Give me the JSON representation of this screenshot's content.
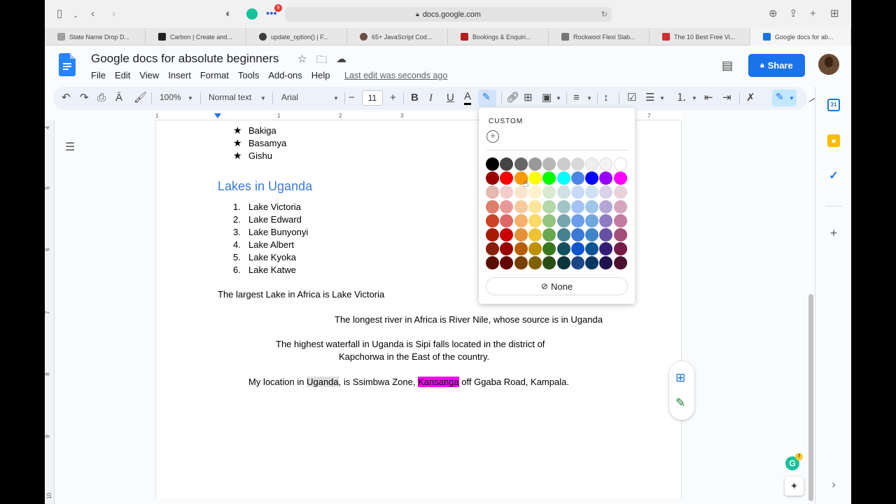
{
  "safari": {
    "url": "docs.google.com",
    "extension_badge": "9",
    "tabs": [
      {
        "label": "State Name Drop D...",
        "color": "#9e9e9e"
      },
      {
        "label": "Carbon | Create and...",
        "color": "#222222"
      },
      {
        "label": "update_option() | F...",
        "color": "#3c3c3c"
      },
      {
        "label": "65+ JavaScript Cod...",
        "color": "#6d4c41"
      },
      {
        "label": "Bookings & Enquiri...",
        "color": "#b71c1c"
      },
      {
        "label": "Rockwool Flexi Slab...",
        "color": "#757575"
      },
      {
        "label": "The 10 Best Free Vi...",
        "color": "#d32f2f"
      },
      {
        "label": "Google docs for ab...",
        "color": "#1a73e8"
      }
    ]
  },
  "docs": {
    "title": "Google docs for absolute beginners",
    "menu": [
      "File",
      "Edit",
      "View",
      "Insert",
      "Format",
      "Tools",
      "Add-ons",
      "Help"
    ],
    "last_edit": "Last edit was seconds ago",
    "share_label": "Share"
  },
  "toolbar": {
    "zoom": "100%",
    "style": "Normal text",
    "font": "Arial",
    "font_size": "11",
    "bold": "B",
    "italic": "I",
    "underline": "U",
    "text_color": "A",
    "minus": "−",
    "plus": "+"
  },
  "ruler": {
    "h_numbers": [
      "1",
      "1",
      "2",
      "3",
      "7"
    ],
    "v_numbers": [
      "4",
      "5",
      "6",
      "7",
      "8",
      "9",
      "10"
    ]
  },
  "document": {
    "star_items": [
      "Bakiga",
      "Basamya",
      "Gishu"
    ],
    "lakes_heading": "Lakes in Uganda",
    "lakes": [
      {
        "num": "1.",
        "name": "Lake Victoria"
      },
      {
        "num": "2.",
        "name": "Lake Edward"
      },
      {
        "num": "3.",
        "name": "Lake Bunyonyi"
      },
      {
        "num": "4.",
        "name": "Lake Albert"
      },
      {
        "num": "5.",
        "name": "Lake Kyoka"
      },
      {
        "num": "6.",
        "name": "Lake Katwe"
      }
    ],
    "largest_lake": "The largest Lake in Africa is Lake Victoria",
    "longest_river": "The longest river in Africa is River Nile, whose source is in Uganda",
    "waterfall_line1": "The highest waterfall in Uganda is Sipi falls located in the district of",
    "waterfall_line2": "Kapchorwa in the East of the country.",
    "location_pre": "My location in ",
    "location_hl1": "Uganda",
    "location_mid": ", is Ssimbwa Zone, ",
    "location_hl2": "Kansanga",
    "location_post": " off Ggaba Road, Kampala."
  },
  "highlight_palette": {
    "custom_label": "CUSTOM",
    "none_label": "None",
    "rows": [
      [
        "#000000",
        "#434343",
        "#666666",
        "#999999",
        "#b7b7b7",
        "#cccccc",
        "#d9d9d9",
        "#efefef",
        "#f3f3f3",
        "#ffffff"
      ],
      [
        "#980000",
        "#ff0000",
        "#ff9900",
        "#ffff00",
        "#00ff00",
        "#00ffff",
        "#4a86e8",
        "#0000ff",
        "#9900ff",
        "#ff00ff"
      ],
      [
        "#e6b8af",
        "#f4cccc",
        "#fce5cd",
        "#fff2cc",
        "#d9ead3",
        "#d0e0e3",
        "#c9daf8",
        "#cfe2f3",
        "#d9d2e9",
        "#ead1dc"
      ],
      [
        "#dd7e6b",
        "#ea9999",
        "#f9cb9c",
        "#ffe599",
        "#b6d7a8",
        "#a2c4c9",
        "#a4c2f4",
        "#9fc5e8",
        "#b4a7d6",
        "#d5a6bd"
      ],
      [
        "#cc4125",
        "#e06666",
        "#f6b26b",
        "#ffd966",
        "#93c47d",
        "#76a5af",
        "#6d9eeb",
        "#6fa8dc",
        "#8e7cc3",
        "#c27ba0"
      ],
      [
        "#a61c00",
        "#cc0000",
        "#e69138",
        "#f1c232",
        "#6aa84f",
        "#45818e",
        "#3c78d8",
        "#3d85c6",
        "#674ea7",
        "#a64d79"
      ],
      [
        "#85200c",
        "#990000",
        "#b45f06",
        "#bf9000",
        "#38761d",
        "#134f5c",
        "#1155cc",
        "#0b5394",
        "#351c75",
        "#741b47"
      ],
      [
        "#5b0f00",
        "#660000",
        "#783f04",
        "#7f6000",
        "#274e13",
        "#0c343d",
        "#1c4587",
        "#073763",
        "#20124d",
        "#4c1130"
      ]
    ]
  },
  "grammarly_badge": "7",
  "calendar_day": "31"
}
